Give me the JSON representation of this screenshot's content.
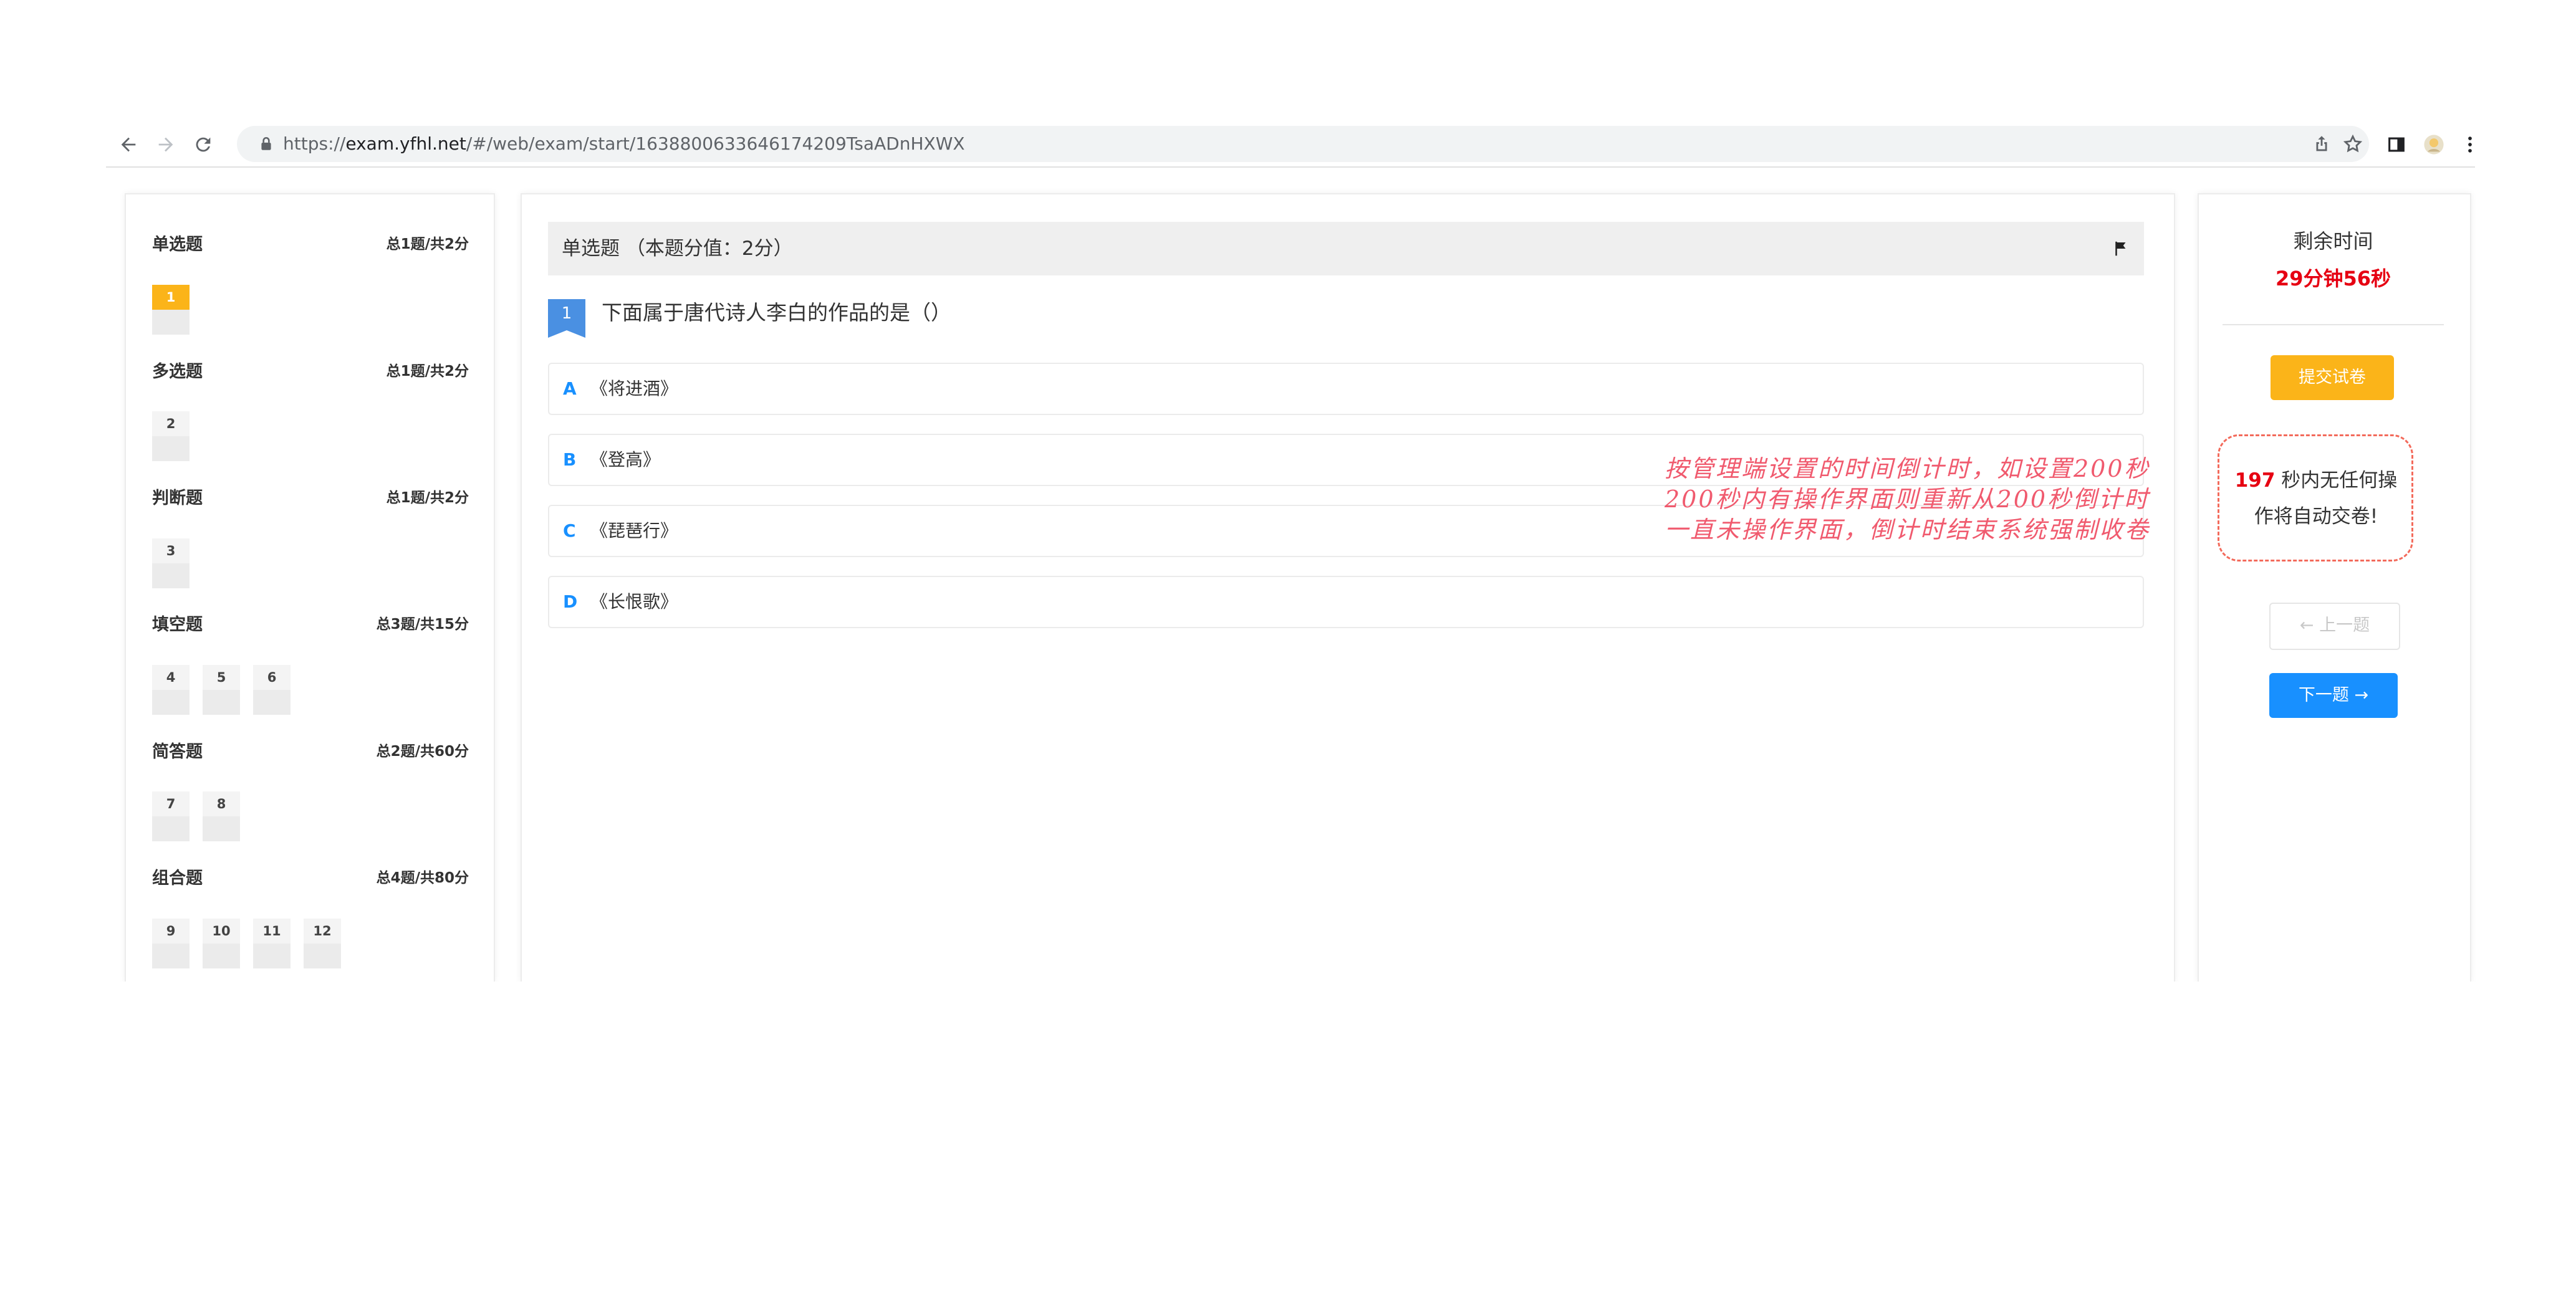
{
  "browser": {
    "url_prefix": "https://",
    "url_host": "exam.yfhl.net",
    "url_path": "/#/web/exam/start/1638800633646174209TsaADnHXWX"
  },
  "sidebar": {
    "sections": [
      {
        "title": "单选题",
        "count": "总1题/共2分",
        "items": [
          "1"
        ],
        "active": "1"
      },
      {
        "title": "多选题",
        "count": "总1题/共2分",
        "items": [
          "2"
        ]
      },
      {
        "title": "判断题",
        "count": "总1题/共2分",
        "items": [
          "3"
        ]
      },
      {
        "title": "填空题",
        "count": "总3题/共15分",
        "items": [
          "4",
          "5",
          "6"
        ]
      },
      {
        "title": "简答题",
        "count": "总2题/共60分",
        "items": [
          "7",
          "8"
        ]
      },
      {
        "title": "组合题",
        "count": "总4题/共80分",
        "items": [
          "9",
          "10",
          "11",
          "12"
        ]
      }
    ]
  },
  "question": {
    "header": "单选题 （本题分值：2分）",
    "number": "1",
    "text": "下面属于唐代诗人李白的作品的是（）",
    "options": [
      {
        "letter": "A",
        "text": "《将进酒》"
      },
      {
        "letter": "B",
        "text": "《登高》"
      },
      {
        "letter": "C",
        "text": "《琵琶行》"
      },
      {
        "letter": "D",
        "text": "《长恨歌》"
      }
    ]
  },
  "timer": {
    "label": "剩余时间",
    "remaining": "29分钟56秒",
    "submit_label": "提交试卷",
    "idle_seconds": "197",
    "idle_text": " 秒内无任何操作将自动交卷!",
    "prev_label": "上一题",
    "next_label": "下一题"
  },
  "annotation": {
    "lines": [
      "按管理端设置的时间倒计时，如设置200秒",
      "200秒内有操作界面则重新从200秒倒计时",
      "一直未操作界面，倒计时结束系统强制收卷"
    ]
  },
  "colors": {
    "accent_blue": "#1890ff",
    "accent_orange": "#fbb419",
    "alert_red": "#e60012",
    "annotation_red": "#f05a6e"
  }
}
